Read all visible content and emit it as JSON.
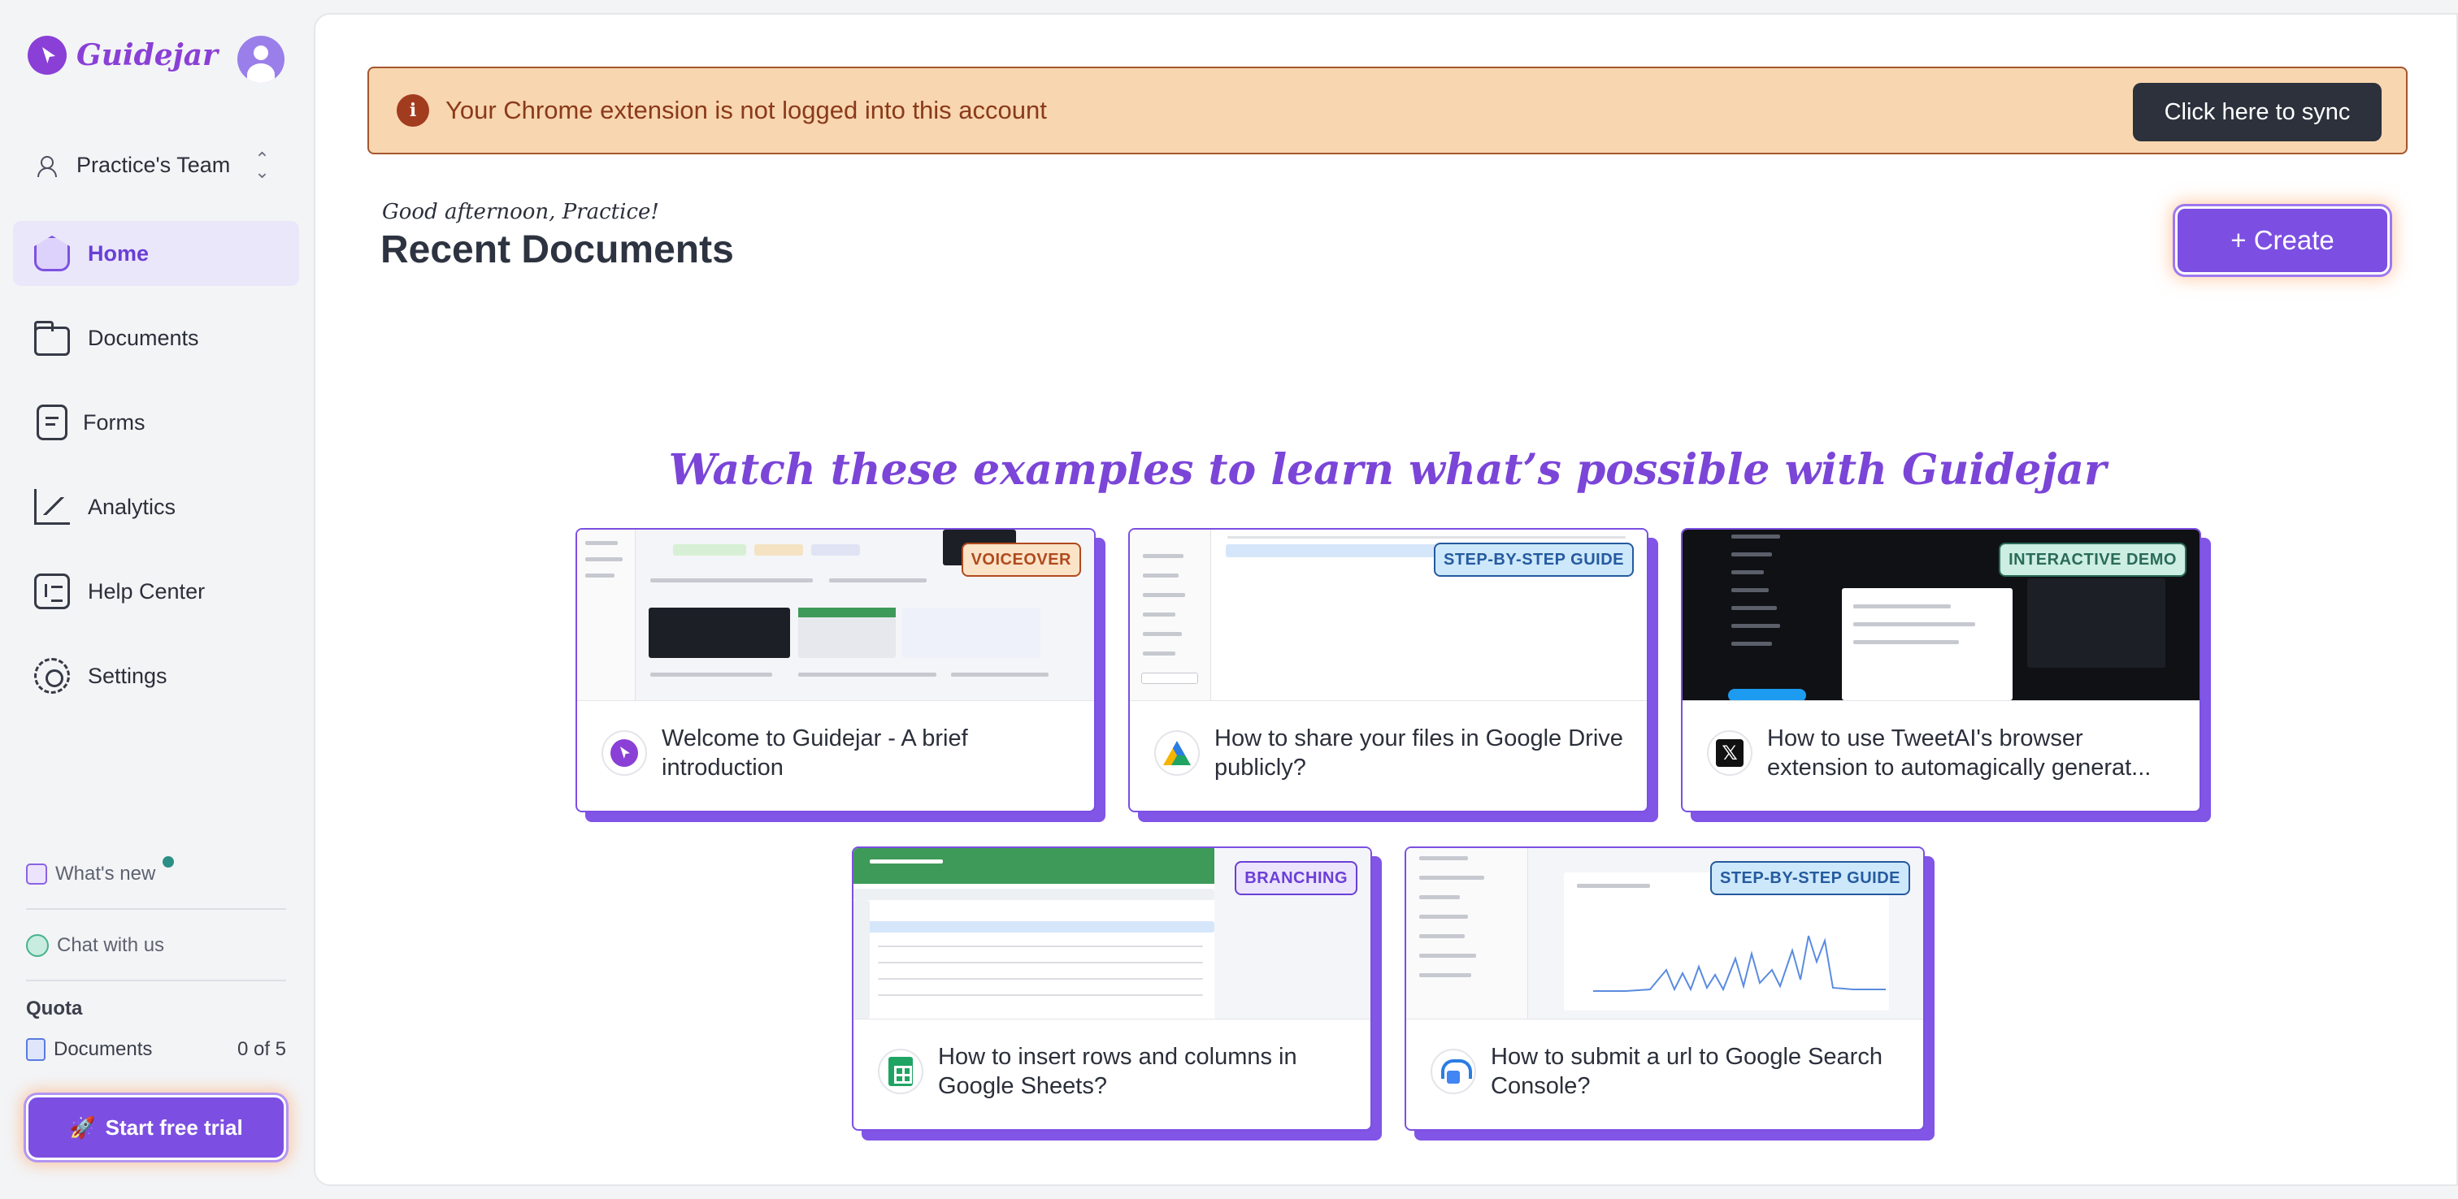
{
  "app": {
    "logo_text": "Guidejar",
    "brand_color": "#7c4fe2"
  },
  "sidebar": {
    "team_label": "Practice's Team",
    "items": [
      {
        "label": "Home",
        "icon": "home-icon",
        "active": true
      },
      {
        "label": "Documents",
        "icon": "folder-icon"
      },
      {
        "label": "Forms",
        "icon": "form-icon"
      },
      {
        "label": "Analytics",
        "icon": "analytics-icon"
      },
      {
        "label": "Help Center",
        "icon": "help-center-icon"
      },
      {
        "label": "Settings",
        "icon": "gear-icon"
      }
    ],
    "whats_new": "What's new",
    "chat": "Chat with us",
    "quota_title": "Quota",
    "quota_label": "Documents",
    "quota_value": "0 of 5",
    "trial_button": "Start free trial"
  },
  "banner": {
    "icon": "info-icon",
    "text": "Your Chrome extension is not logged into this account",
    "button": "Click here to sync",
    "color": "#f8d6b0"
  },
  "header": {
    "greeting": "Good afternoon, Practice!",
    "title": "Recent Documents",
    "create_button": "+ Create"
  },
  "examples": {
    "heading": "Watch these examples to learn what’s possible with Guidejar",
    "cards": [
      {
        "title": "Welcome to Guidejar - A brief introduction",
        "badge": "VOICEOVER",
        "icon": "guidejar-icon"
      },
      {
        "title": "How to share your files in Google Drive publicly?",
        "badge": "STEP-BY-STEP GUIDE",
        "icon": "google-drive-icon"
      },
      {
        "title": "How to use TweetAI's browser extension to automagically generat...",
        "badge": "INTERACTIVE DEMO",
        "icon": "x-icon"
      },
      {
        "title": "How to insert rows and columns in Google Sheets?",
        "badge": "BRANCHING",
        "icon": "google-sheets-icon"
      },
      {
        "title": "How to submit a url to Google Search Console?",
        "badge": "STEP-BY-STEP GUIDE",
        "icon": "search-console-icon"
      }
    ]
  }
}
